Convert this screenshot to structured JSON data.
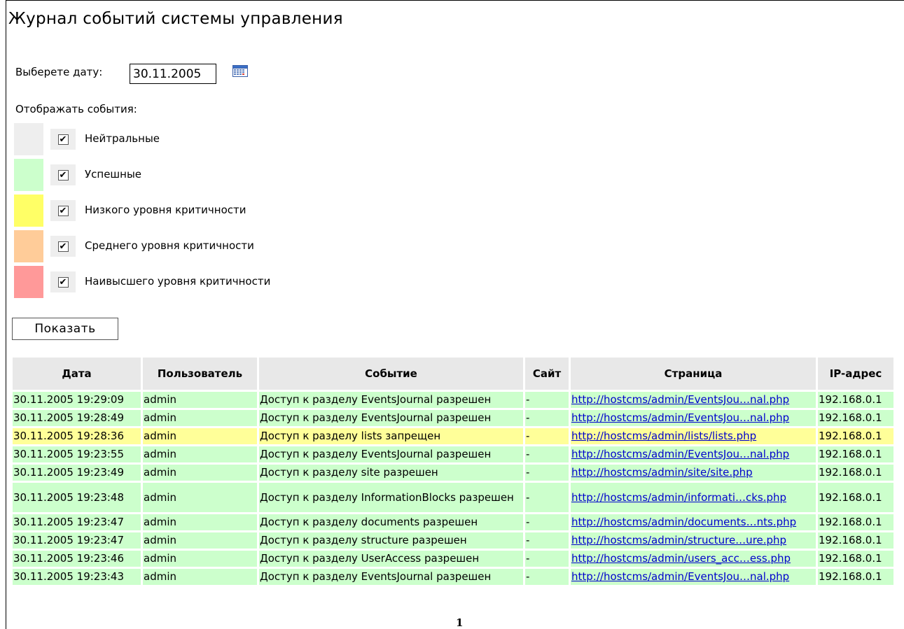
{
  "page": {
    "title": "Журнал событий системы управления",
    "page_number": "1"
  },
  "date_filter": {
    "label": "Выберете дату:",
    "value": "30.11.2005",
    "calendar_icon": "calendar-icon"
  },
  "events_filter": {
    "label": "Отображать события:",
    "items": [
      {
        "label": "Нейтральные",
        "checked": true,
        "color": "#eeeeee"
      },
      {
        "label": "Успешные",
        "checked": true,
        "color": "#ccffcc"
      },
      {
        "label": "Низкого уровня критичности",
        "checked": true,
        "color": "#ffff66"
      },
      {
        "label": "Среднего уровня критичности",
        "checked": true,
        "color": "#ffcc99"
      },
      {
        "label": "Наивысшего уровня критичности",
        "checked": true,
        "color": "#ff9999"
      }
    ]
  },
  "show_button": "Показать",
  "log_table": {
    "headers": [
      "Дата",
      "Пользователь",
      "Событие",
      "Сайт",
      "Страница",
      "IP-адрес"
    ],
    "rows": [
      {
        "level": "success",
        "date": "30.11.2005 19:29:09",
        "user": "admin",
        "event": "Доступ к разделу EventsJournal разрешен",
        "site": "-",
        "page": "http://hostcms/admin/EventsJou…nal.php",
        "ip": "192.168.0.1"
      },
      {
        "level": "success",
        "date": "30.11.2005 19:28:49",
        "user": "admin",
        "event": "Доступ к разделу EventsJournal разрешен",
        "site": "-",
        "page": "http://hostcms/admin/EventsJou…nal.php",
        "ip": "192.168.0.1"
      },
      {
        "level": "low",
        "date": "30.11.2005 19:28:36",
        "user": "admin",
        "event": "Доступ к разделу lists запрещен",
        "site": "-",
        "page": "http://hostcms/admin/lists/lists.php",
        "ip": "192.168.0.1"
      },
      {
        "level": "success",
        "date": "30.11.2005 19:23:55",
        "user": "admin",
        "event": "Доступ к разделу EventsJournal разрешен",
        "site": "-",
        "page": "http://hostcms/admin/EventsJou…nal.php",
        "ip": "192.168.0.1"
      },
      {
        "level": "success",
        "date": "30.11.2005 19:23:49",
        "user": "admin",
        "event": "Доступ к разделу site разрешен",
        "site": "-",
        "page": "http://hostcms/admin/site/site.php",
        "ip": "192.168.0.1"
      },
      {
        "level": "success",
        "date": "30.11.2005 19:23:48",
        "user": "admin",
        "event": "Доступ к разделу InformationBlocks разрешен",
        "site": "-",
        "page": "http://hostcms/admin/informati…cks.php",
        "ip": "192.168.0.1"
      },
      {
        "level": "success",
        "date": "30.11.2005 19:23:47",
        "user": "admin",
        "event": "Доступ к разделу documents разрешен",
        "site": "-",
        "page": "http://hostcms/admin/documents…nts.php",
        "ip": "192.168.0.1"
      },
      {
        "level": "success",
        "date": "30.11.2005 19:23:47",
        "user": "admin",
        "event": "Доступ к разделу structure разрешен",
        "site": "-",
        "page": "http://hostcms/admin/structure…ure.php",
        "ip": "192.168.0.1"
      },
      {
        "level": "success",
        "date": "30.11.2005 19:23:46",
        "user": "admin",
        "event": "Доступ к разделу UserAccess разрешен",
        "site": "-",
        "page": "http://hostcms/admin/users_acc…ess.php",
        "ip": "192.168.0.1"
      },
      {
        "level": "success",
        "date": "30.11.2005 19:23:43",
        "user": "admin",
        "event": "Доступ к разделу EventsJournal разрешен",
        "site": "-",
        "page": "http://hostcms/admin/EventsJou…nal.php",
        "ip": "192.168.0.1"
      }
    ]
  }
}
